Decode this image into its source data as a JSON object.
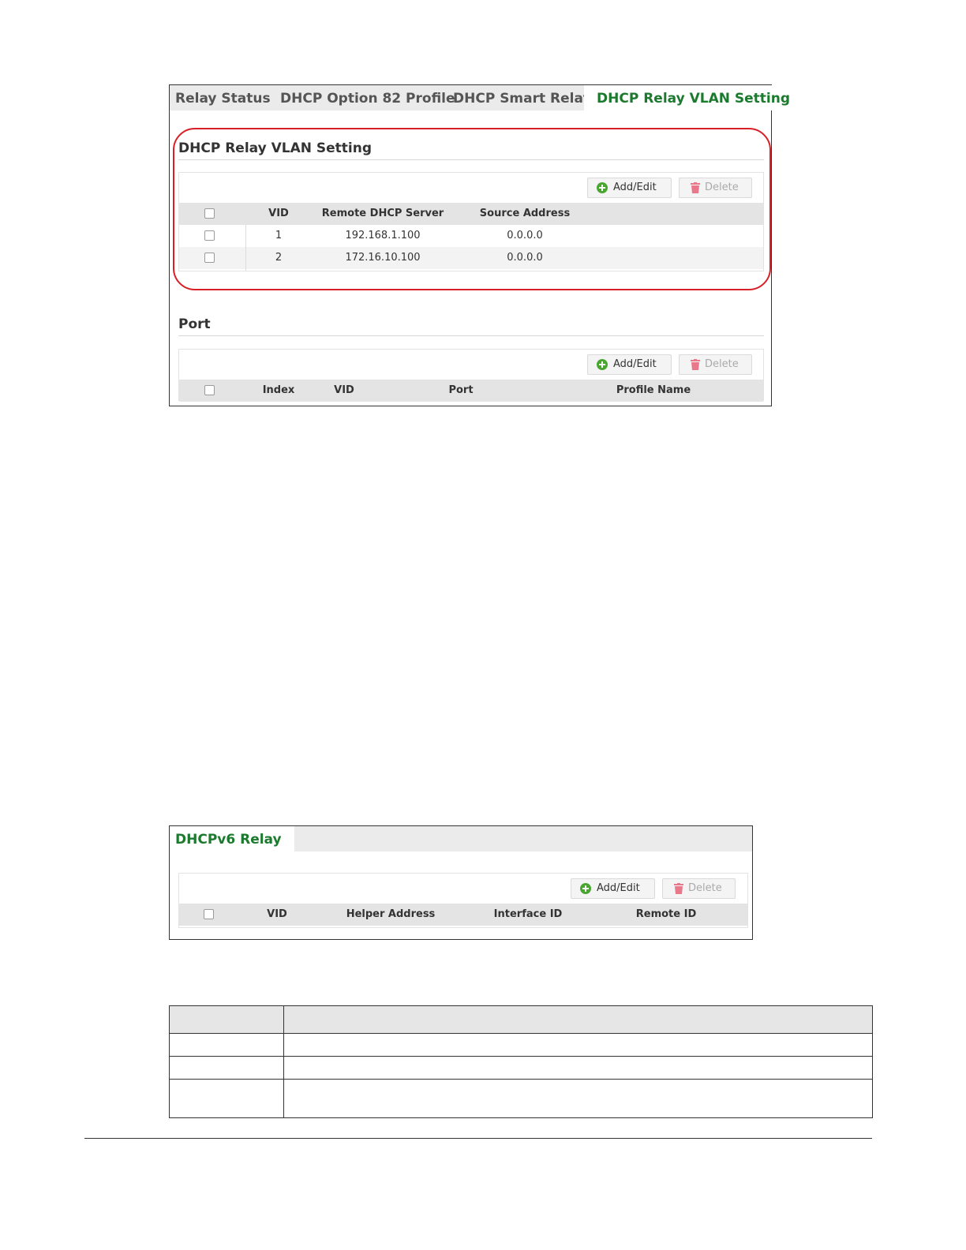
{
  "relay_panel": {
    "tabs": [
      {
        "label": "Relay Status",
        "active": false
      },
      {
        "label": "DHCP Option 82 Profile",
        "active": false
      },
      {
        "label": "DHCP Smart Relay",
        "active": false
      },
      {
        "label": "DHCP Relay VLAN Setting",
        "active": true
      }
    ],
    "vlan_section": {
      "title": "DHCP Relay VLAN Setting",
      "add_label": "Add/Edit",
      "delete_label": "Delete",
      "columns": [
        "VID",
        "Remote DHCP Server",
        "Source Address"
      ],
      "rows": [
        {
          "vid": "1",
          "server": "192.168.1.100",
          "source": "0.0.0.0"
        },
        {
          "vid": "2",
          "server": "172.16.10.100",
          "source": "0.0.0.0"
        }
      ]
    },
    "port_section": {
      "title": "Port",
      "add_label": "Add/Edit",
      "delete_label": "Delete",
      "columns": [
        "Index",
        "VID",
        "Port",
        "Profile Name"
      ]
    }
  },
  "dhcpv6_panel": {
    "tab": "DHCPv6 Relay",
    "add_label": "Add/Edit",
    "delete_label": "Delete",
    "columns": [
      "VID",
      "Helper Address",
      "Interface ID",
      "Remote ID"
    ]
  },
  "colors": {
    "active_tab": "#1b7a2e",
    "highlight": "#d92027",
    "add_icon": "#4aa630",
    "delete_icon": "#e8788a"
  }
}
